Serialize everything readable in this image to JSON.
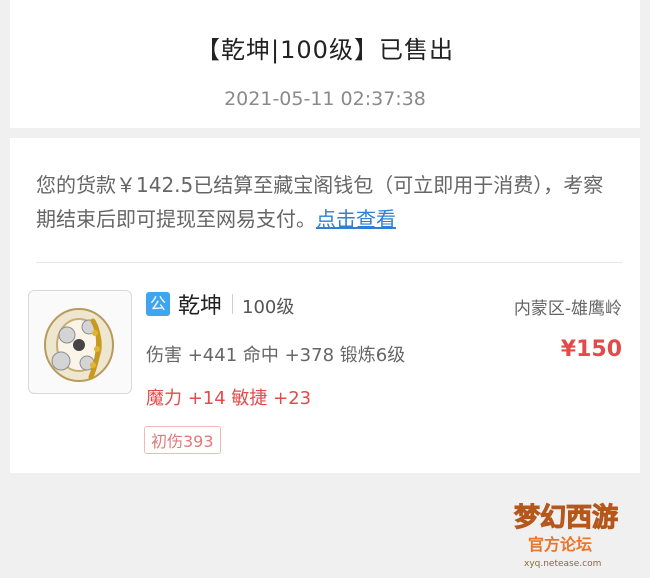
{
  "header": {
    "title": "【乾坤|100级】已售出",
    "timestamp": "2021-05-11 02:37:38"
  },
  "notice": {
    "text": "您的货款￥142.5已结算至藏宝阁钱包（可立即用于消费），考察期结束后即可提现至网易支付。",
    "link_label": "点击查看"
  },
  "item": {
    "badge": "公",
    "name": "乾坤",
    "level": "100级",
    "server": "内蒙区-雄鹰岭",
    "attrs": "伤害 +441 命中 +378 锻炼6级",
    "magic": "魔力 +14 敏捷 +23",
    "price": "¥150",
    "tag": "初伤393"
  },
  "watermark": {
    "line1": "梦幻西游",
    "line2": "官方论坛",
    "url": "xyq.netease.com"
  },
  "colors": {
    "accent_blue": "#3ea5f0",
    "link_blue": "#2f7fd6",
    "price_red": "#e24b4b"
  }
}
